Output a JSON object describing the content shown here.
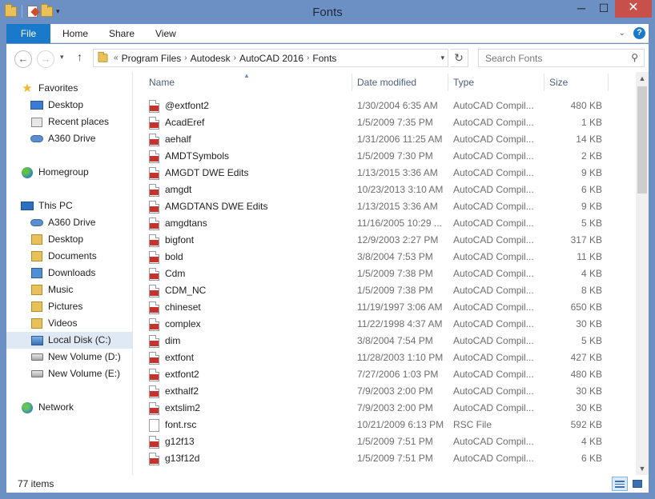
{
  "window": {
    "title": "Fonts",
    "min": "─",
    "max": "☐",
    "close": "✕"
  },
  "ribbon": {
    "tabs": [
      "File",
      "Home",
      "Share",
      "View"
    ],
    "help": "?",
    "expand": "⌄"
  },
  "nav": {
    "back": "←",
    "forward": "→",
    "recent": "▾",
    "up": "↑",
    "overflow": "«",
    "breadcrumbs": [
      "Program Files",
      "Autodesk",
      "AutoCAD 2016",
      "Fonts"
    ],
    "crumb_sep": "›",
    "addr_drop": "▾",
    "refresh": "↻",
    "search_placeholder": "Search Fonts",
    "search_icon": "⚲"
  },
  "sidebar": {
    "favorites": {
      "label": "Favorites",
      "items": [
        "Desktop",
        "Recent places",
        "A360 Drive"
      ]
    },
    "homegroup": "Homegroup",
    "thispc": {
      "label": "This PC",
      "items": [
        "A360 Drive",
        "Desktop",
        "Documents",
        "Downloads",
        "Music",
        "Pictures",
        "Videos",
        "Local Disk (C:)",
        "New Volume (D:)",
        "New Volume (E:)"
      ]
    },
    "network": "Network"
  },
  "columns": {
    "name": "Name",
    "date": "Date modified",
    "type": "Type",
    "size": "Size",
    "sort_indicator": "▲"
  },
  "files": [
    {
      "name": "@extfont2",
      "date": "1/30/2004 6:35 AM",
      "type": "AutoCAD Compil...",
      "size": "480 KB",
      "icon": "shx"
    },
    {
      "name": "AcadEref",
      "date": "1/5/2009 7:35 PM",
      "type": "AutoCAD Compil...",
      "size": "1 KB",
      "icon": "shx"
    },
    {
      "name": "aehalf",
      "date": "1/31/2006 11:25 AM",
      "type": "AutoCAD Compil...",
      "size": "14 KB",
      "icon": "shx"
    },
    {
      "name": "AMDTSymbols",
      "date": "1/5/2009 7:30 PM",
      "type": "AutoCAD Compil...",
      "size": "2 KB",
      "icon": "shx"
    },
    {
      "name": "AMGDT DWE Edits",
      "date": "1/13/2015 3:36 AM",
      "type": "AutoCAD Compil...",
      "size": "9 KB",
      "icon": "shx"
    },
    {
      "name": "amgdt",
      "date": "10/23/2013 3:10 AM",
      "type": "AutoCAD Compil...",
      "size": "6 KB",
      "icon": "shx"
    },
    {
      "name": "AMGDTANS DWE Edits",
      "date": "1/13/2015 3:36 AM",
      "type": "AutoCAD Compil...",
      "size": "9 KB",
      "icon": "shx"
    },
    {
      "name": "amgdtans",
      "date": "11/16/2005 10:29 ...",
      "type": "AutoCAD Compil...",
      "size": "5 KB",
      "icon": "shx"
    },
    {
      "name": "bigfont",
      "date": "12/9/2003 2:27 PM",
      "type": "AutoCAD Compil...",
      "size": "317 KB",
      "icon": "shx"
    },
    {
      "name": "bold",
      "date": "3/8/2004 7:53 PM",
      "type": "AutoCAD Compil...",
      "size": "11 KB",
      "icon": "shx"
    },
    {
      "name": "Cdm",
      "date": "1/5/2009 7:38 PM",
      "type": "AutoCAD Compil...",
      "size": "4 KB",
      "icon": "shx"
    },
    {
      "name": "CDM_NC",
      "date": "1/5/2009 7:38 PM",
      "type": "AutoCAD Compil...",
      "size": "8 KB",
      "icon": "shx"
    },
    {
      "name": "chineset",
      "date": "11/19/1997 3:06 AM",
      "type": "AutoCAD Compil...",
      "size": "650 KB",
      "icon": "shx"
    },
    {
      "name": "complex",
      "date": "11/22/1998 4:37 AM",
      "type": "AutoCAD Compil...",
      "size": "30 KB",
      "icon": "shx"
    },
    {
      "name": "dim",
      "date": "3/8/2004 7:54 PM",
      "type": "AutoCAD Compil...",
      "size": "5 KB",
      "icon": "shx"
    },
    {
      "name": "extfont",
      "date": "11/28/2003 1:10 PM",
      "type": "AutoCAD Compil...",
      "size": "427 KB",
      "icon": "shx"
    },
    {
      "name": "extfont2",
      "date": "7/27/2006 1:03 PM",
      "type": "AutoCAD Compil...",
      "size": "480 KB",
      "icon": "shx"
    },
    {
      "name": "exthalf2",
      "date": "7/9/2003 2:00 PM",
      "type": "AutoCAD Compil...",
      "size": "30 KB",
      "icon": "shx"
    },
    {
      "name": "extslim2",
      "date": "7/9/2003 2:00 PM",
      "type": "AutoCAD Compil...",
      "size": "30 KB",
      "icon": "shx"
    },
    {
      "name": "font.rsc",
      "date": "10/21/2009 6:13 PM",
      "type": "RSC File",
      "size": "592 KB",
      "icon": "doc"
    },
    {
      "name": "g12f13",
      "date": "1/5/2009 7:51 PM",
      "type": "AutoCAD Compil...",
      "size": "4 KB",
      "icon": "shx"
    },
    {
      "name": "g13f12d",
      "date": "1/5/2009 7:51 PM",
      "type": "AutoCAD Compil...",
      "size": "6 KB",
      "icon": "shx"
    }
  ],
  "scroll": {
    "up": "▲",
    "down": "▼"
  },
  "status": {
    "count": "77 items"
  }
}
